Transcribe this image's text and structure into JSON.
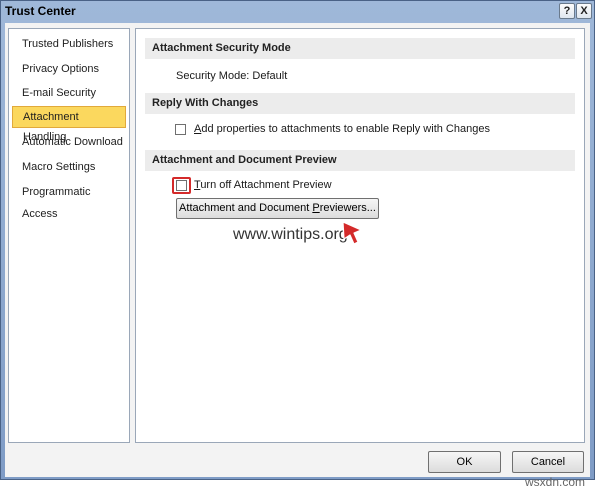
{
  "window": {
    "title": "Trust Center",
    "help_symbol": "?",
    "close_symbol": "X"
  },
  "nav": {
    "items": [
      {
        "label": "Trusted Publishers"
      },
      {
        "label": "Privacy Options"
      },
      {
        "label": "E-mail Security"
      },
      {
        "label": "Attachment Handling"
      },
      {
        "label": "Automatic Download"
      },
      {
        "label": "Macro Settings"
      },
      {
        "label": "Programmatic Access"
      }
    ],
    "selected": "Attachment Handling"
  },
  "sections": {
    "security_mode": {
      "heading": "Attachment Security Mode",
      "value_text": "Security Mode: Default"
    },
    "reply": {
      "heading": "Reply With Changes",
      "option_label_key": "A",
      "option_label_rest": "dd properties to attachments to enable Reply with Changes",
      "checked": false
    },
    "preview": {
      "heading": "Attachment and Document Preview",
      "option_label_key": "T",
      "option_label_rest": "urn off Attachment Preview",
      "checked": false,
      "button_pre": "Attachment and Document ",
      "button_key": "P",
      "button_post": "reviewers..."
    }
  },
  "footer": {
    "ok_label": "OK",
    "cancel_label": "Cancel"
  },
  "watermarks": {
    "site": "www.wintips.org",
    "corner": "wsxdn.com"
  },
  "colors": {
    "title_gradient_top": "#9fb8d9",
    "nav_selected": "#fbd85e",
    "highlight_red": "#d42a2a",
    "section_header": "#ececec"
  }
}
